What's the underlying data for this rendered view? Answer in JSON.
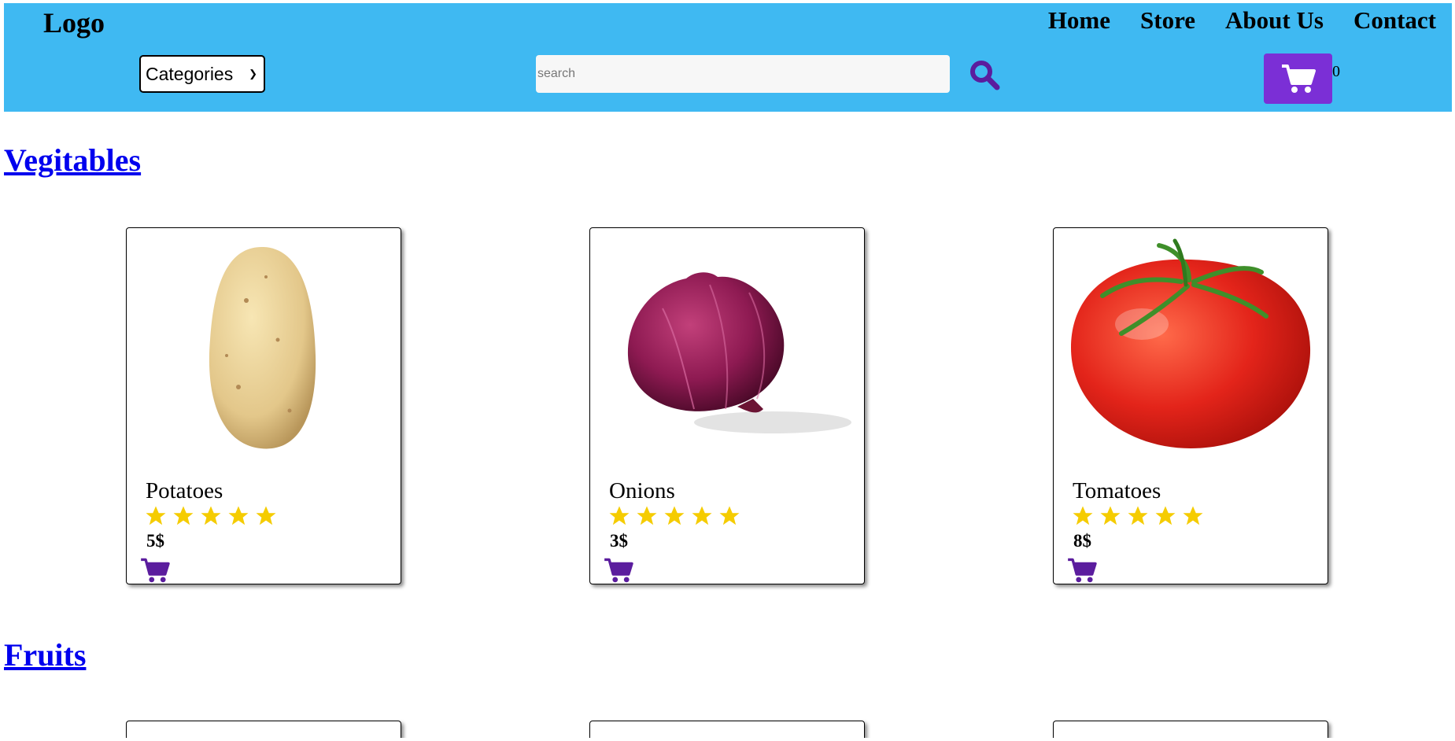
{
  "header": {
    "logo": "Logo",
    "nav": [
      "Home",
      "Store",
      "About Us",
      "Contact"
    ],
    "categories_selected": "Categories",
    "search_placeholder": "search",
    "cart_count": "0",
    "colors": {
      "header_bg": "#3fb9f2",
      "accent": "#7b2fd6",
      "icon_purple": "#5b1d9e"
    }
  },
  "sections": [
    {
      "title": "Vegitables",
      "products": [
        {
          "name": "Potatoes",
          "rating": 5,
          "price": "5$",
          "image": "potato"
        },
        {
          "name": "Onions",
          "rating": 5,
          "price": "3$",
          "image": "red-onion"
        },
        {
          "name": "Tomatoes",
          "rating": 5,
          "price": "8$",
          "image": "tomato"
        }
      ]
    },
    {
      "title": "Fruits"
    }
  ],
  "icons": [
    "search-icon",
    "cart-icon",
    "star-icon",
    "add-to-cart-icon",
    "chevron-down-icon"
  ]
}
